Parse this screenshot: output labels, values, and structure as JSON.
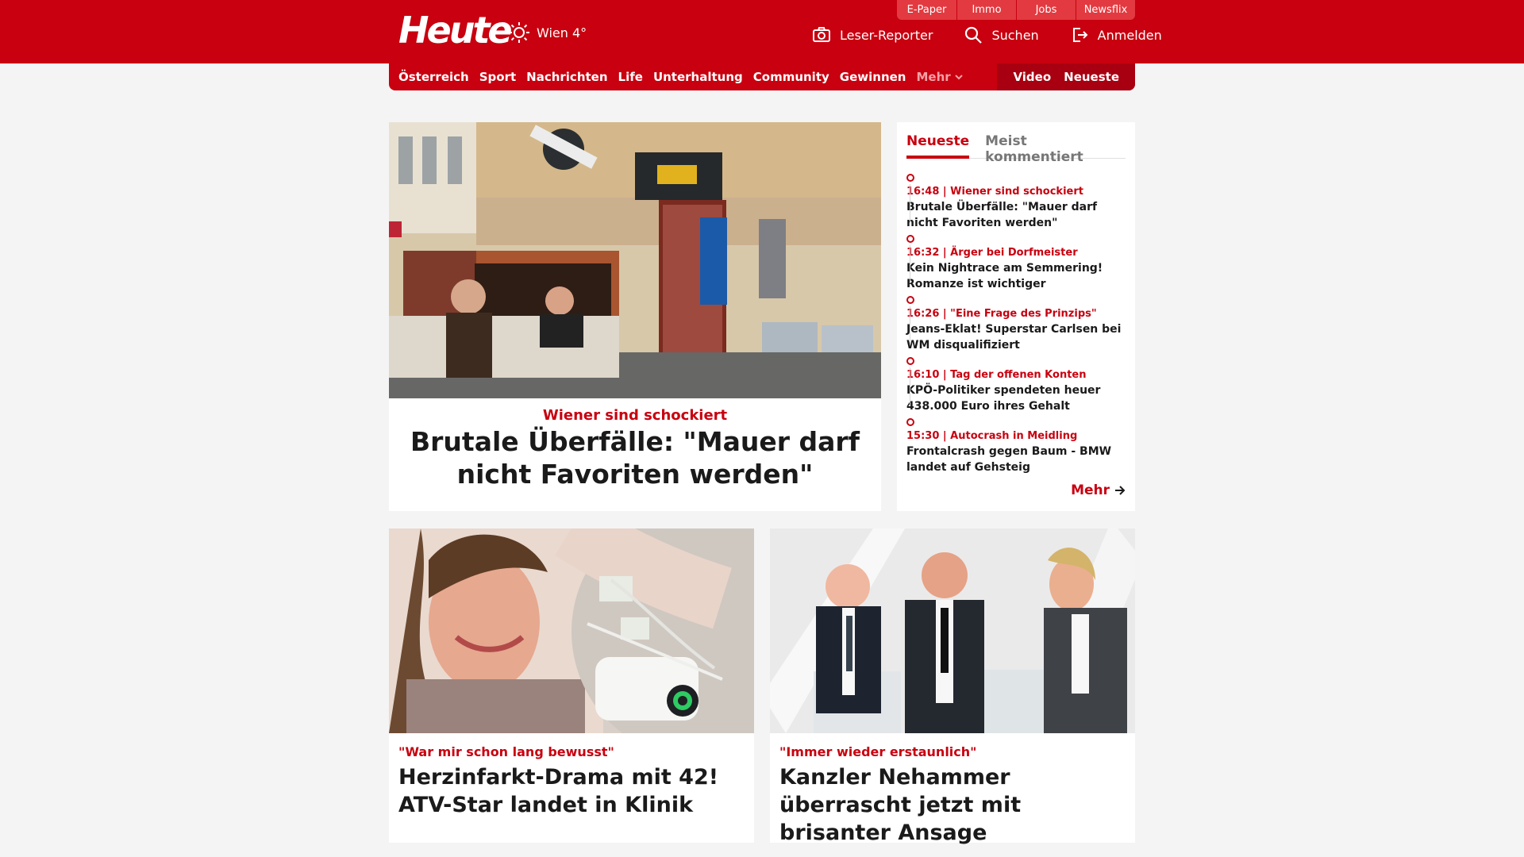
{
  "utility_tabs": [
    "E-Paper",
    "Immo",
    "Jobs",
    "Newsflix"
  ],
  "header": {
    "logo": "Heute",
    "weather": "Wien 4°",
    "actions": [
      "Leser-Reporter",
      "Suchen",
      "Anmelden"
    ]
  },
  "nav": {
    "items": [
      "Österreich",
      "Sport",
      "Nachrichten",
      "Life",
      "Unterhaltung",
      "Community",
      "Gewinnen"
    ],
    "more": "Mehr",
    "right": [
      "Video",
      "Neueste"
    ]
  },
  "hero": {
    "kicker": "Wiener sind schockiert",
    "title": "Brutale Überfälle: \"Mauer darf nicht Favoriten werden\""
  },
  "sidebar": {
    "tabs": [
      "Neueste",
      "Meist kommentiert"
    ],
    "items": [
      {
        "meta": "16:48 | Wiener sind schockiert",
        "title": "Brutale Überfälle: \"Mauer darf nicht Favoriten werden\""
      },
      {
        "meta": "16:32 | Ärger bei Dorfmeister",
        "title": "Kein Nightrace am Semmering! Romanze ist wichtiger"
      },
      {
        "meta": "16:26 | \"Eine Frage des Prinzips\"",
        "title": "Jeans-Eklat! Superstar Carlsen bei WM disqualifiziert"
      },
      {
        "meta": "16:10 | Tag der offenen Konten",
        "title": "KPÖ-Politiker spendeten heuer 438.000 Euro ihres Gehalt"
      },
      {
        "meta": "15:30 | Autocrash in Meidling",
        "title": "Frontalcrash gegen Baum - BMW landet auf Gehsteig"
      }
    ],
    "more": "Mehr"
  },
  "cards": [
    {
      "kicker": "\"War mir schon lang bewusst\"",
      "title": "Herzinfarkt-Drama mit 42! ATV-Star landet in Klinik"
    },
    {
      "kicker": "\"Immer wieder erstaunlich\"",
      "title": "Kanzler Nehammer überrascht jetzt mit brisanter Ansage"
    }
  ],
  "colors": {
    "brand": "#c8000f",
    "background": "#f4f4f4"
  }
}
